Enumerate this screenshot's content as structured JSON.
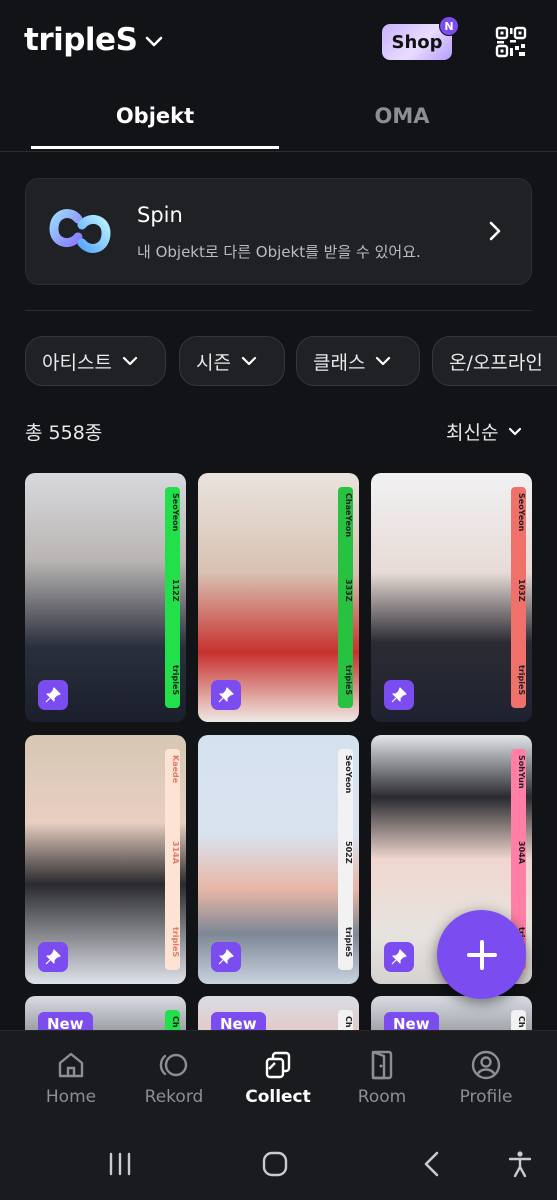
{
  "header": {
    "title": "tripleS",
    "shop_label": "Shop",
    "shop_badge": "N"
  },
  "tabs": [
    {
      "label": "Objekt",
      "active": true
    },
    {
      "label": "OMA",
      "active": false
    }
  ],
  "spin": {
    "title": "Spin",
    "subtitle": "내 Objekt로 다른 Objekt를 받을 수 있어요."
  },
  "filters": [
    "아티스트",
    "시즌",
    "클래스",
    "온/오프라인"
  ],
  "list": {
    "count_label": "총 558종",
    "sort_label": "최신순"
  },
  "cards": [
    {
      "member": "SeoYeon",
      "number": "112Z",
      "group": "tripleS",
      "stripe_color": "#22e04a",
      "pinned": true
    },
    {
      "member": "ChaeYeon",
      "number": "333Z",
      "group": "tripleS",
      "stripe_color": "#27c23f",
      "pinned": true
    },
    {
      "member": "SeoYeon",
      "number": "103Z",
      "group": "tripleS",
      "stripe_color": "#f0706a",
      "pinned": true
    },
    {
      "member": "Kaede",
      "number": "314A",
      "group": "tripleS",
      "stripe_color": "#fde3d4",
      "pinned": true
    },
    {
      "member": "SeoYeon",
      "number": "502Z",
      "group": "tripleS",
      "stripe_color": "#f2f2f2",
      "pinned": true
    },
    {
      "member": "SohYun",
      "number": "304A",
      "group": "tripleS",
      "stripe_color": "#ff7fa6",
      "pinned": true
    },
    {
      "new_label": "New",
      "member": "Ch",
      "stripe_color": "#22e04a"
    },
    {
      "new_label": "New",
      "member": "Ch",
      "stripe_color": "#f2f2f2"
    },
    {
      "new_label": "New",
      "member": "Ch",
      "stripe_color": "#f2f2f2"
    }
  ],
  "nav": [
    {
      "label": "Home",
      "icon": "home-icon",
      "active": false
    },
    {
      "label": "Rekord",
      "icon": "rekord-icon",
      "active": false
    },
    {
      "label": "Collect",
      "icon": "collect-icon",
      "active": true
    },
    {
      "label": "Room",
      "icon": "door-icon",
      "active": false
    },
    {
      "label": "Profile",
      "icon": "profile-icon",
      "active": false
    }
  ],
  "colors": {
    "accent": "#7b4cf0",
    "background": "#121316",
    "card_bg": "#1f2125"
  }
}
